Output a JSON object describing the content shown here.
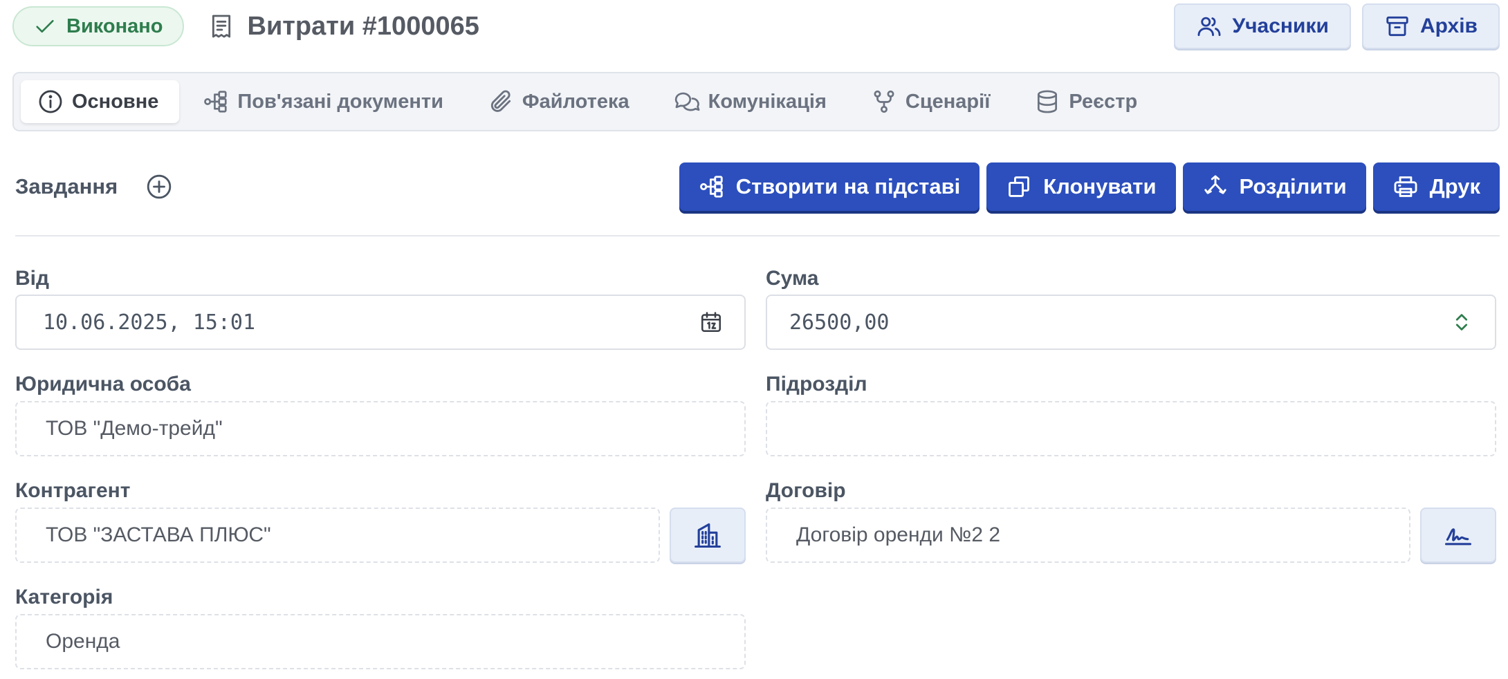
{
  "header": {
    "status": "Виконано",
    "title": "Витрати #1000065",
    "participants_label": "Учасники",
    "archive_label": "Архів"
  },
  "tabs": [
    {
      "label": "Основне",
      "icon": "info-icon",
      "active": true
    },
    {
      "label": "Пов'язані документи",
      "icon": "linked-docs-icon",
      "active": false
    },
    {
      "label": "Файлотека",
      "icon": "paperclip-icon",
      "active": false
    },
    {
      "label": "Комунікація",
      "icon": "chat-icon",
      "active": false
    },
    {
      "label": "Сценарії",
      "icon": "workflow-icon",
      "active": false
    },
    {
      "label": "Реєстр",
      "icon": "database-icon",
      "active": false
    }
  ],
  "tasks": {
    "label": "Завдання"
  },
  "actions": {
    "create_based_on": "Створити на підставі",
    "clone": "Клонувати",
    "split": "Розділити",
    "print": "Друк"
  },
  "form": {
    "from_label": "Від",
    "from_value": "10.06.2025, 15:01",
    "sum_label": "Сума",
    "sum_value": "26500,00",
    "legal_entity_label": "Юридична особа",
    "legal_entity_value": "ТОВ \"Демо-трейд\"",
    "department_label": "Підрозділ",
    "department_value": "",
    "counterparty_label": "Контрагент",
    "counterparty_value": "ТОВ \"ЗАСТАВА ПЛЮС\"",
    "contract_label": "Договір",
    "contract_value": "Договір оренди №2 2",
    "category_label": "Категорія",
    "category_value": "Оренда"
  },
  "colors": {
    "primary": "#2c4fbd",
    "status_green": "#2e7d4d",
    "soft_button_bg": "#e8eef8"
  }
}
